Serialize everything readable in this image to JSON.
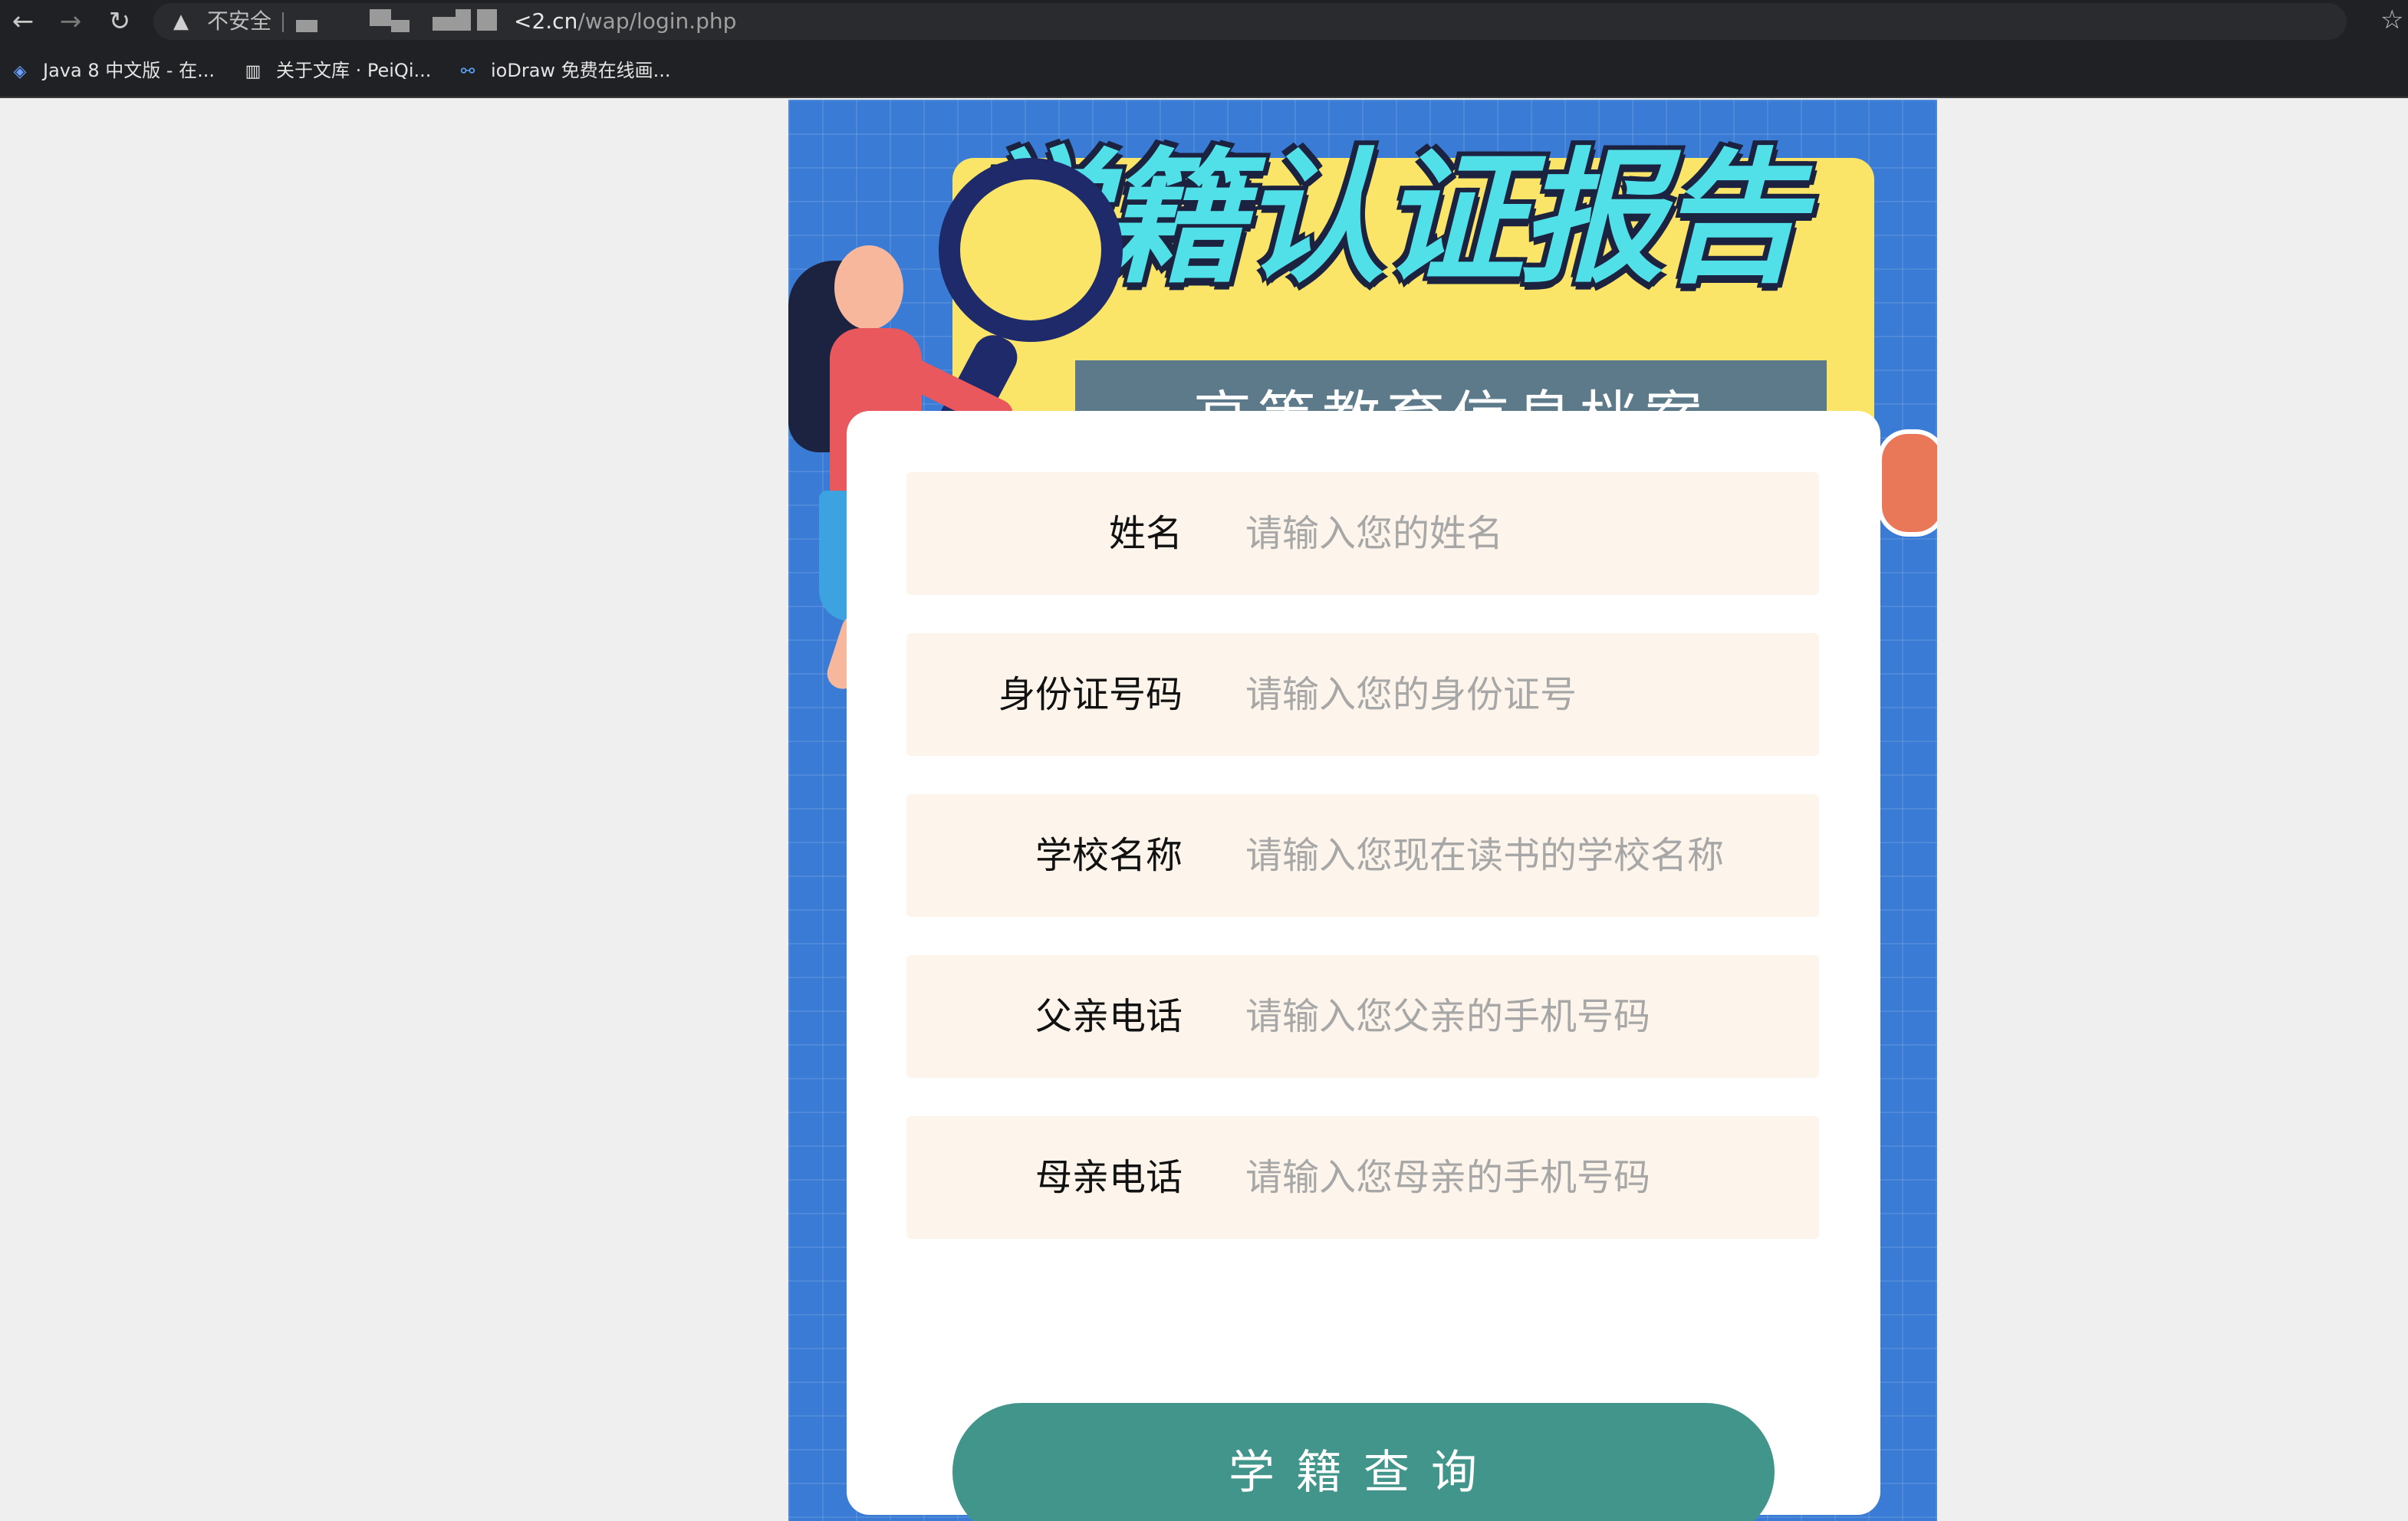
{
  "browser": {
    "security_label": "不安全",
    "url_domain_visible": "<2.cn",
    "url_path": "/wap/login.php",
    "bookmarks": [
      {
        "label": "Java 8 中文版 - 在..."
      },
      {
        "label": "关于文库 · PeiQi..."
      },
      {
        "label": "ioDraw 免费在线画..."
      }
    ]
  },
  "banner": {
    "title": "学籍认证报告",
    "subtitle": "高等教育信息档案"
  },
  "form": {
    "fields": [
      {
        "label": "姓名",
        "placeholder": "请输入您的姓名"
      },
      {
        "label": "身份证号码",
        "placeholder": "请输入您的身份证号"
      },
      {
        "label": "学校名称",
        "placeholder": "请输入您现在读书的学校名称"
      },
      {
        "label": "父亲电话",
        "placeholder": "请输入您父亲的手机号码"
      },
      {
        "label": "母亲电话",
        "placeholder": "请输入您母亲的手机号码"
      }
    ],
    "submit_label": "学籍查询"
  },
  "colors": {
    "page_bg": "#efefef",
    "phone_bg": "#3a7bd5",
    "banner_yellow": "#fbe569",
    "field_bg": "#fdf5ec",
    "button": "#42958a"
  },
  "icons": {
    "back": "arrow-left-icon",
    "forward": "arrow-right-icon",
    "reload": "reload-icon",
    "warning": "warning-triangle-icon",
    "key": "key-icon",
    "share": "share-icon",
    "star": "star-icon"
  }
}
